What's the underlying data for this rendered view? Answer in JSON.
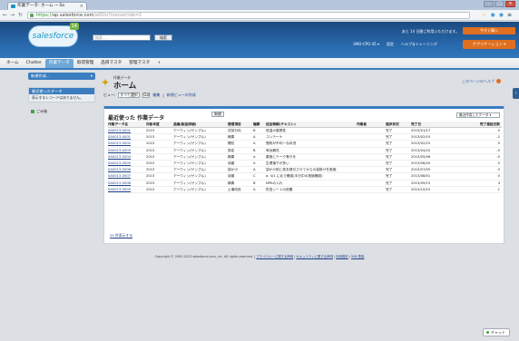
{
  "browser": {
    "tab_title": "作業データ: ホーム ~ Sa",
    "url_https": "https://",
    "url_host": "ap.salesforce.com",
    "url_path": "/a00/o?nooverride=1",
    "back_icon": "arrow-left-icon",
    "forward_icon": "arrow-right-icon",
    "reload_icon": "reload-icon"
  },
  "header": {
    "logo_text": "salesforce",
    "logo_badge": "14",
    "search_placeholder": "検索...",
    "search_button": "検索",
    "promo_text": "あと 14 日間ご利用いただけます。",
    "promo_button": "今すぐ購入",
    "user_menu": "UNO-CPO 45 ▾",
    "setup": "設定",
    "help_training": "ヘルプ＆トレーニング",
    "app_menu": "アプリケーション ▾"
  },
  "tabs": [
    "ホーム",
    "Chatter",
    "作業データ",
    "取得管理",
    "品目マスタ",
    "管理マスタ",
    "+"
  ],
  "active_tab_index": 2,
  "sidebar": {
    "create_new": "新規作成...",
    "recent_title": "最近使ったデータ",
    "recent_empty": "表示するレコードはありません。",
    "trash": "ごみ箱"
  },
  "page": {
    "object_label": "作業データ",
    "title": "ホーム",
    "help_link": "このページのヘルプ",
    "view_label": "ビュー:",
    "view_select": "すべて選択",
    "view_go": "Go!",
    "view_edit": "編集",
    "view_separator": " | ",
    "view_create": "新規ビューの作成"
  },
  "panel": {
    "title": "最近使った 作業データ",
    "new_button": "新規",
    "sort_select": "最近作成したデータ ▾",
    "columns": [
      "作業データ名",
      "対象年度",
      "品種(製品詳細)",
      "管理項目",
      "種類",
      "追加情報(テキスト)",
      "作業者",
      "進捗状況",
      "完了日",
      "完了遅延日数"
    ],
    "rows": [
      [
        "SA0013-0001",
        "2013",
        "アーウィン(サンプル)",
        "花芽分化",
        "B",
        "低温の感受性",
        "",
        "完了",
        "2013/01/17",
        "0"
      ],
      [
        "SA0013-0001",
        "2013",
        "アーウィン(サンプル)",
        "摘果",
        "A",
        "コンテーナ",
        "",
        "完了",
        "2013/02/10",
        "-2"
      ],
      [
        "SA0013-0002",
        "2013",
        "アーウィン(サンプル)",
        "開花",
        "A",
        "受粉が不均一な状況",
        "",
        "完了",
        "2013/02/15",
        "0"
      ],
      [
        "SA0013-0003",
        "2013",
        "アーウィン(サンプル)",
        "剪定",
        "B",
        "有効摘花",
        "",
        "完了",
        "2013/04/10",
        "-5"
      ],
      [
        "SA0013-0004",
        "2013",
        "アーウィン(サンプル)",
        "摘果",
        "A",
        "果実にテーク巻きを",
        "",
        "完了",
        "2013/05/06",
        "-5"
      ],
      [
        "SA0013-0005",
        "2013",
        "アーウィン(サンプル)",
        "収穫",
        "A",
        "生理落下が多い",
        "",
        "完了",
        "2013/06/20",
        "5"
      ],
      [
        "SA0013-0006",
        "2013",
        "アーウィン(サンプル)",
        "袋かけ",
        "A",
        "袋かけ前に枝を誘引させてからの袋掛けを実施",
        "",
        "完了",
        "2013/07/05",
        "-3"
      ],
      [
        "SA0013-0007",
        "2013",
        "アーウィン(サンプル)",
        "収穫",
        "C",
        "a. 4/1 に北で確認(半日中の実施確認)",
        "",
        "完了",
        "2013/08/01",
        "0"
      ],
      [
        "SA0013-0008",
        "2013",
        "アーウィン(サンプル)",
        "摘果",
        "B",
        "NPKの入れ",
        "",
        "完了",
        "2013/09/15",
        "4"
      ],
      [
        "SA0013-0009",
        "2013",
        "アーウィン(サンプル)",
        "土壌改良",
        "A",
        "防虫シートの設置",
        "",
        "完了",
        "2013/10/10",
        "1"
      ]
    ],
    "more_link": "25 件表示する"
  },
  "footer": {
    "copyright": "Copyright © 2000-2013 salesforce.com, inc. All rights reserved. |",
    "links": [
      "プライバシーに関する声明",
      "セキュリティに関する声明",
      "利用規約",
      "508 準拠"
    ]
  },
  "chat_label": "チャット"
}
